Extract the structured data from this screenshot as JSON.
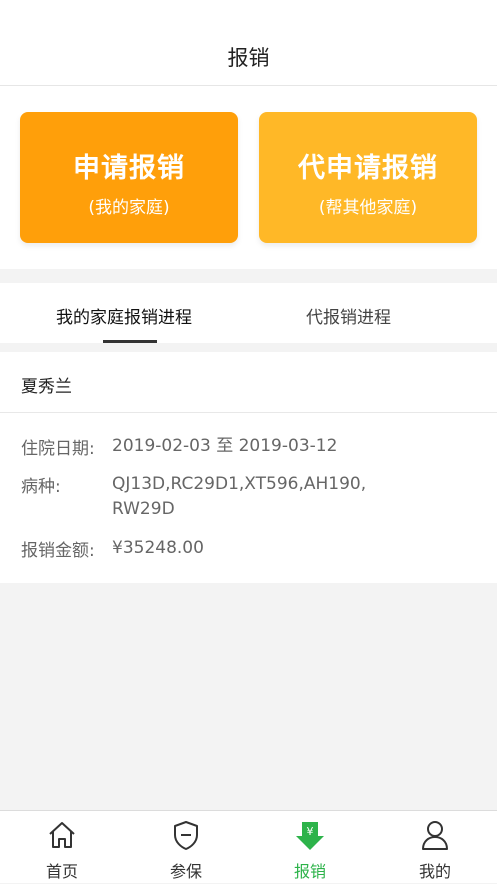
{
  "header": {
    "title": "报销"
  },
  "actions": {
    "apply": {
      "title": "申请报销",
      "subtitle": "(我的家庭)"
    },
    "proxy_apply": {
      "title": "代申请报销",
      "subtitle": "(帮其他家庭)"
    }
  },
  "tabs": [
    {
      "label": "我的家庭报销进程",
      "active": true
    },
    {
      "label": "代报销进程",
      "active": false
    }
  ],
  "record": {
    "name": "夏秀兰",
    "fields": [
      {
        "label": "住院日期:",
        "value": "2019-02-03 至 2019-03-12"
      },
      {
        "label": "病种:",
        "value": "QJ13D,RC29D1,XT596,AH190, RW29D"
      },
      {
        "label": "报销金额:",
        "value": "¥35248.00"
      }
    ]
  },
  "tabbar": [
    {
      "label": "首页",
      "icon": "home-icon",
      "active": false
    },
    {
      "label": "参保",
      "icon": "shield-icon",
      "active": false
    },
    {
      "label": "报销",
      "icon": "yen-download-icon",
      "active": true
    },
    {
      "label": "我的",
      "icon": "user-icon",
      "active": false
    }
  ],
  "colors": {
    "apply_card": "#ff9f0a",
    "proxy_card": "#ffb827",
    "active_tab": "#2db34a"
  }
}
